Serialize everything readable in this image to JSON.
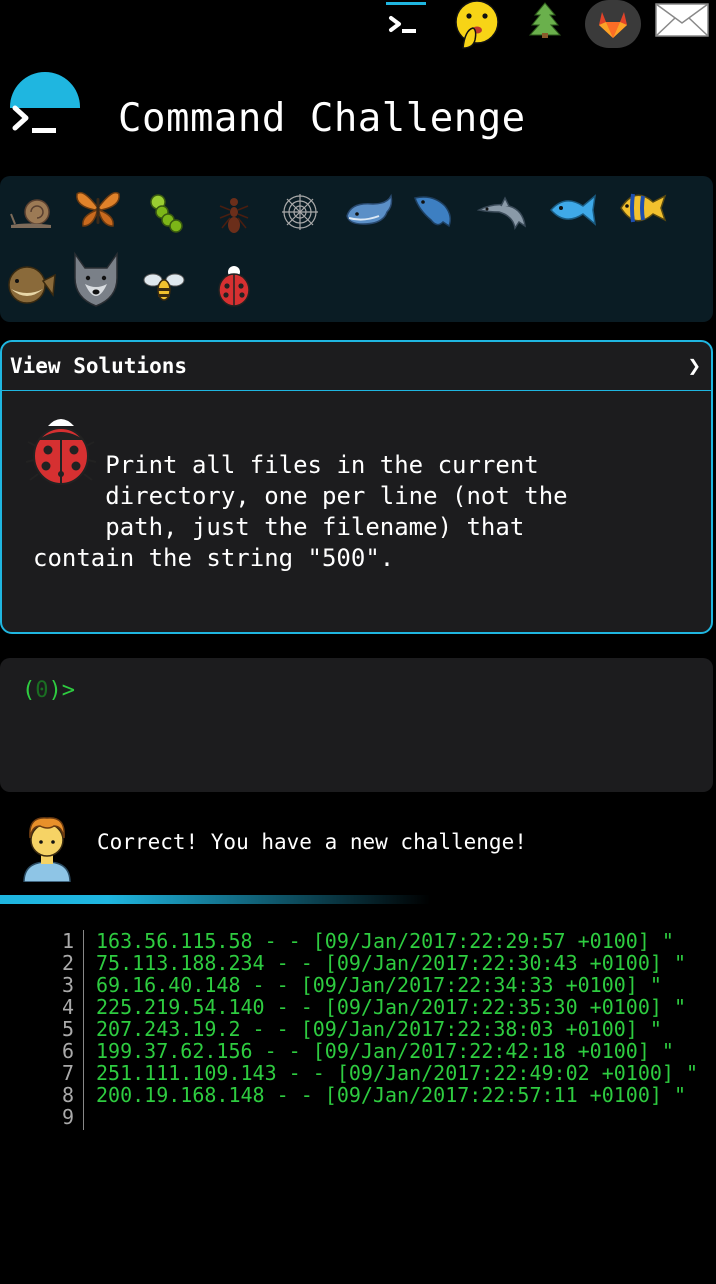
{
  "nav": {
    "icons": [
      "terminal-icon",
      "shushing-face-icon",
      "tree-icon",
      "gitlab-icon",
      "mail-icon"
    ]
  },
  "header": {
    "title": "Command Challenge"
  },
  "badges": [
    "snail-icon",
    "butterfly-icon",
    "caterpillar-icon",
    "ant-icon",
    "spider-web-icon",
    "whale-icon",
    "whale-2-icon",
    "dolphin-icon",
    "fish-icon",
    "tropical-fish-icon",
    "blowfish-icon",
    "wolf-icon",
    "bee-icon",
    "ladybug-icon"
  ],
  "solutions": {
    "title": "View Solutions",
    "chevron": "❯",
    "challenge_text": "     Print all files in the current\n     directory, one per line (not the\n     path, just the filename) that\ncontain the string \"500\"."
  },
  "terminal": {
    "prompt_open": "(",
    "prompt_count": "0",
    "prompt_close": ")>"
  },
  "feedback": {
    "message": "Correct! You have a new challenge!"
  },
  "output": {
    "lines": [
      {
        "n": "1",
        "t": "163.56.115.58 - - [09/Jan/2017:22:29:57 +0100] \""
      },
      {
        "n": "2",
        "t": "75.113.188.234 - - [09/Jan/2017:22:30:43 +0100] \""
      },
      {
        "n": "3",
        "t": "69.16.40.148 - - [09/Jan/2017:22:34:33 +0100] \""
      },
      {
        "n": "4",
        "t": "225.219.54.140 - - [09/Jan/2017:22:35:30 +0100] \""
      },
      {
        "n": "5",
        "t": "207.243.19.2 - - [09/Jan/2017:22:38:03 +0100] \""
      },
      {
        "n": "6",
        "t": "199.37.62.156 - - [09/Jan/2017:22:42:18 +0100] \""
      },
      {
        "n": "7",
        "t": "251.111.109.143 - - [09/Jan/2017:22:49:02 +0100] \""
      },
      {
        "n": "8",
        "t": "200.19.168.148 - - [09/Jan/2017:22:57:11 +0100] \""
      },
      {
        "n": "9",
        "t": ""
      }
    ]
  },
  "colors": {
    "accent": "#1fb6e0",
    "terminal_green": "#2ecc40",
    "panel": "#1c1c1e",
    "badge_panel": "#0a1c24"
  }
}
